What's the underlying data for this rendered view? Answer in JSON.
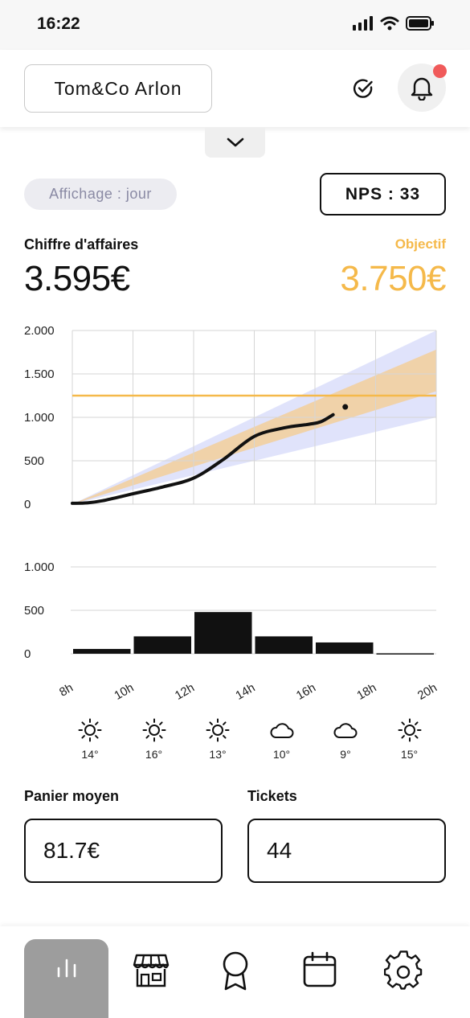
{
  "status_bar": {
    "time": "16:22"
  },
  "header": {
    "store_name": "Tom&Co Arlon"
  },
  "filters": {
    "view_mode": "Affichage : jour",
    "nps": "NPS : 33"
  },
  "revenue": {
    "label": "Chiffre d'affaires",
    "value": "3.595€",
    "target_label": "Objectif",
    "target_value": "3.750€"
  },
  "chart_data": [
    {
      "type": "line",
      "x": [
        "8h",
        "10h",
        "12h",
        "14h",
        "16h",
        "18h",
        "20h"
      ],
      "ylim": [
        0,
        2000
      ],
      "yticks": [
        "0",
        "500",
        "1.000",
        "1.500",
        "2.000"
      ],
      "series": [
        {
          "x_hours": [
            8,
            8.5,
            9,
            10,
            11,
            12,
            13,
            14,
            15,
            15.8,
            16.2,
            16.6
          ],
          "values": [
            10,
            15,
            40,
            120,
            200,
            300,
            520,
            780,
            880,
            920,
            950,
            1030
          ]
        }
      ],
      "target_line": 1250,
      "projection_band_outer": {
        "x_hours": [
          8,
          20
        ],
        "upper": [
          0,
          2000
        ],
        "lower": [
          0,
          1000
        ]
      },
      "projection_band_inner": {
        "x_hours": [
          8,
          20
        ],
        "upper": [
          0,
          1780
        ],
        "lower": [
          0,
          1300
        ]
      },
      "end_point": {
        "x_hour": 17,
        "value": 1120
      },
      "colors": {
        "line": "#111111",
        "target": "#f5b94a",
        "outer_band": "#dde0fb",
        "inner_band": "#f2cfa0",
        "grid": "#d6d6d6"
      }
    },
    {
      "type": "bar",
      "categories": [
        "8h-10h",
        "10h-12h",
        "12h-14h",
        "14h-16h",
        "16h-18h",
        "18h-20h"
      ],
      "values": [
        55,
        200,
        480,
        200,
        130,
        5
      ],
      "ylim": [
        0,
        1000
      ],
      "yticks": [
        "0",
        "500",
        "1.000"
      ],
      "xticks": [
        "8h",
        "10h",
        "12h",
        "14h",
        "16h",
        "18h",
        "20h"
      ],
      "colors": {
        "bar": "#111111",
        "grid": "#d6d6d6"
      }
    }
  ],
  "weather": [
    {
      "icon": "sun-icon",
      "temp": "14°"
    },
    {
      "icon": "sun-icon",
      "temp": "16°"
    },
    {
      "icon": "sun-icon",
      "temp": "13°"
    },
    {
      "icon": "cloud-icon",
      "temp": "10°"
    },
    {
      "icon": "cloud-icon",
      "temp": "9°"
    },
    {
      "icon": "sun-icon",
      "temp": "15°"
    }
  ],
  "kpis": {
    "basket": {
      "label": "Panier moyen",
      "value": "81.7€"
    },
    "tickets": {
      "label": "Tickets",
      "value": "44"
    }
  },
  "nav": {
    "items": [
      {
        "icon": "bar-chart-icon",
        "active": true
      },
      {
        "icon": "store-icon",
        "active": false
      },
      {
        "icon": "award-icon",
        "active": false
      },
      {
        "icon": "calendar-icon",
        "active": false
      },
      {
        "icon": "gear-icon",
        "active": false
      }
    ]
  }
}
